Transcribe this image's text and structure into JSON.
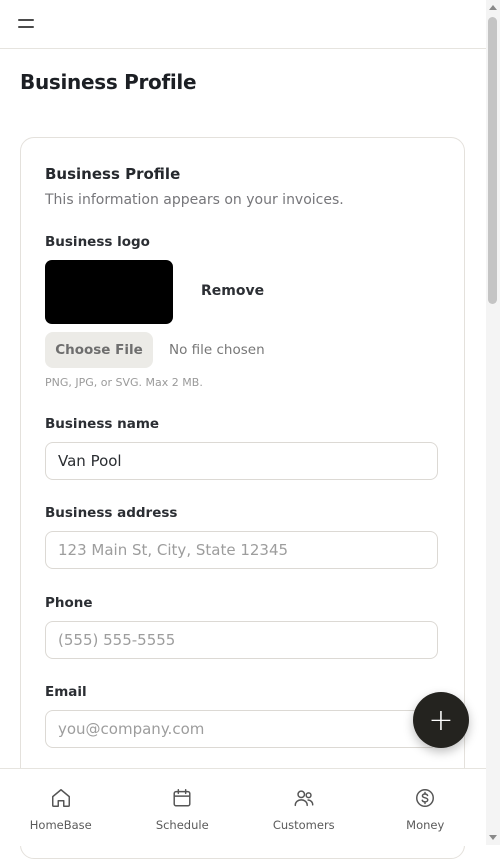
{
  "header": {
    "menu_icon": "menu-icon"
  },
  "page": {
    "title": "Business Profile"
  },
  "card": {
    "title": "Business Profile",
    "subtitle": "This information appears on your invoices.",
    "logo": {
      "label": "Business logo",
      "remove_label": "Remove",
      "choose_file_label": "Choose File",
      "file_status": "No file chosen",
      "hint": "PNG, JPG, or SVG. Max 2 MB."
    },
    "fields": {
      "name": {
        "label": "Business name",
        "value": "Van Pool",
        "placeholder": ""
      },
      "address": {
        "label": "Business address",
        "value": "",
        "placeholder": "123 Main St, City, State 12345"
      },
      "phone": {
        "label": "Phone",
        "value": "",
        "placeholder": "(555) 555-5555"
      },
      "email": {
        "label": "Email",
        "value": "",
        "placeholder": "you@company.com"
      }
    }
  },
  "fab": {
    "label": "+",
    "icon": "plus-icon"
  },
  "bottom_nav": {
    "items": [
      {
        "label": "HomeBase",
        "icon": "home-icon"
      },
      {
        "label": "Schedule",
        "icon": "calendar-icon"
      },
      {
        "label": "Customers",
        "icon": "users-icon"
      },
      {
        "label": "Money",
        "icon": "dollar-circle-icon"
      }
    ]
  },
  "colors": {
    "fab_bg": "#24231f",
    "logo_bg": "#000000",
    "border": "#e4e1dc"
  }
}
